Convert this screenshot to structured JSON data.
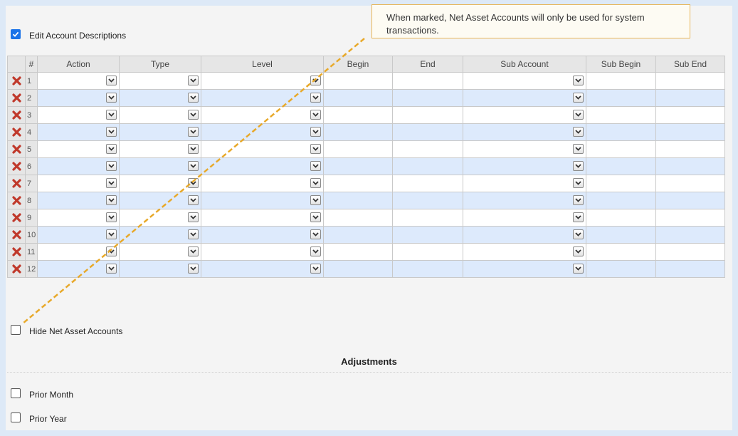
{
  "edit_descriptions": {
    "label": "Edit Account Descriptions",
    "checked": true
  },
  "tooltip": {
    "text": "When marked, Net Asset Accounts will only be used for system transactions."
  },
  "table": {
    "columns": [
      "#",
      "Action",
      "Type",
      "Level",
      "Begin",
      "End",
      "Sub Account",
      "Sub Begin",
      "Sub End"
    ],
    "rows": [
      "1",
      "2",
      "3",
      "4",
      "5",
      "6",
      "7",
      "8",
      "9",
      "10",
      "11",
      "12"
    ]
  },
  "hide_net_asset": {
    "label": "Hide Net Asset Accounts",
    "checked": false
  },
  "adjustments": {
    "title": "Adjustments",
    "prior_month": {
      "label": "Prior Month",
      "checked": false
    },
    "prior_year": {
      "label": "Prior Year",
      "checked": false
    }
  },
  "colors": {
    "accent": "#1a73e8",
    "delete": "#c0392b",
    "tooltip_border": "#e7b65a",
    "row_alt": "#ddeafc"
  },
  "icons": {
    "delete": "x-delete-icon",
    "dropdown": "chevron-down-icon",
    "checkbox": "checkmark-icon"
  }
}
